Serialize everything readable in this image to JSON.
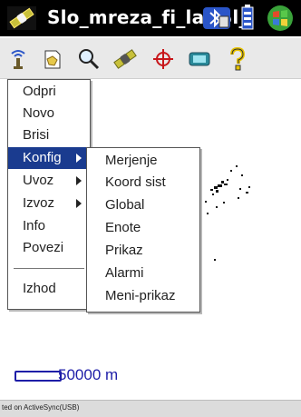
{
  "window": {
    "title": "Slo_mreza_fi_la [Sl_"
  },
  "toolbar": {
    "icons": [
      "antenna-icon",
      "open-map-icon",
      "search-icon",
      "satellite-icon",
      "crosshair-icon",
      "device-icon",
      "help-icon"
    ]
  },
  "menu": {
    "items": [
      {
        "label": "Odpri"
      },
      {
        "label": "Novo"
      },
      {
        "label": "Brisi"
      },
      {
        "label": "Konfig",
        "selected": true,
        "submenu": true
      },
      {
        "label": "Uvoz",
        "submenu": true
      },
      {
        "label": "Izvoz",
        "submenu": true
      },
      {
        "label": "Info"
      },
      {
        "label": "Povezi"
      },
      {
        "label": "Izhod"
      }
    ]
  },
  "submenu": {
    "items": [
      "Merjenje",
      "Koord sist",
      "Global",
      "Enote",
      "Prikaz",
      "Alarmi",
      "Meni-prikaz"
    ]
  },
  "map": {
    "scale_label": "50000 m"
  },
  "status": {
    "text": "ted on ActiveSync(USB)"
  },
  "colors": {
    "titlebar": "#000000",
    "menu_highlight": "#1a3b8f",
    "scale": "#1e1ea8"
  }
}
